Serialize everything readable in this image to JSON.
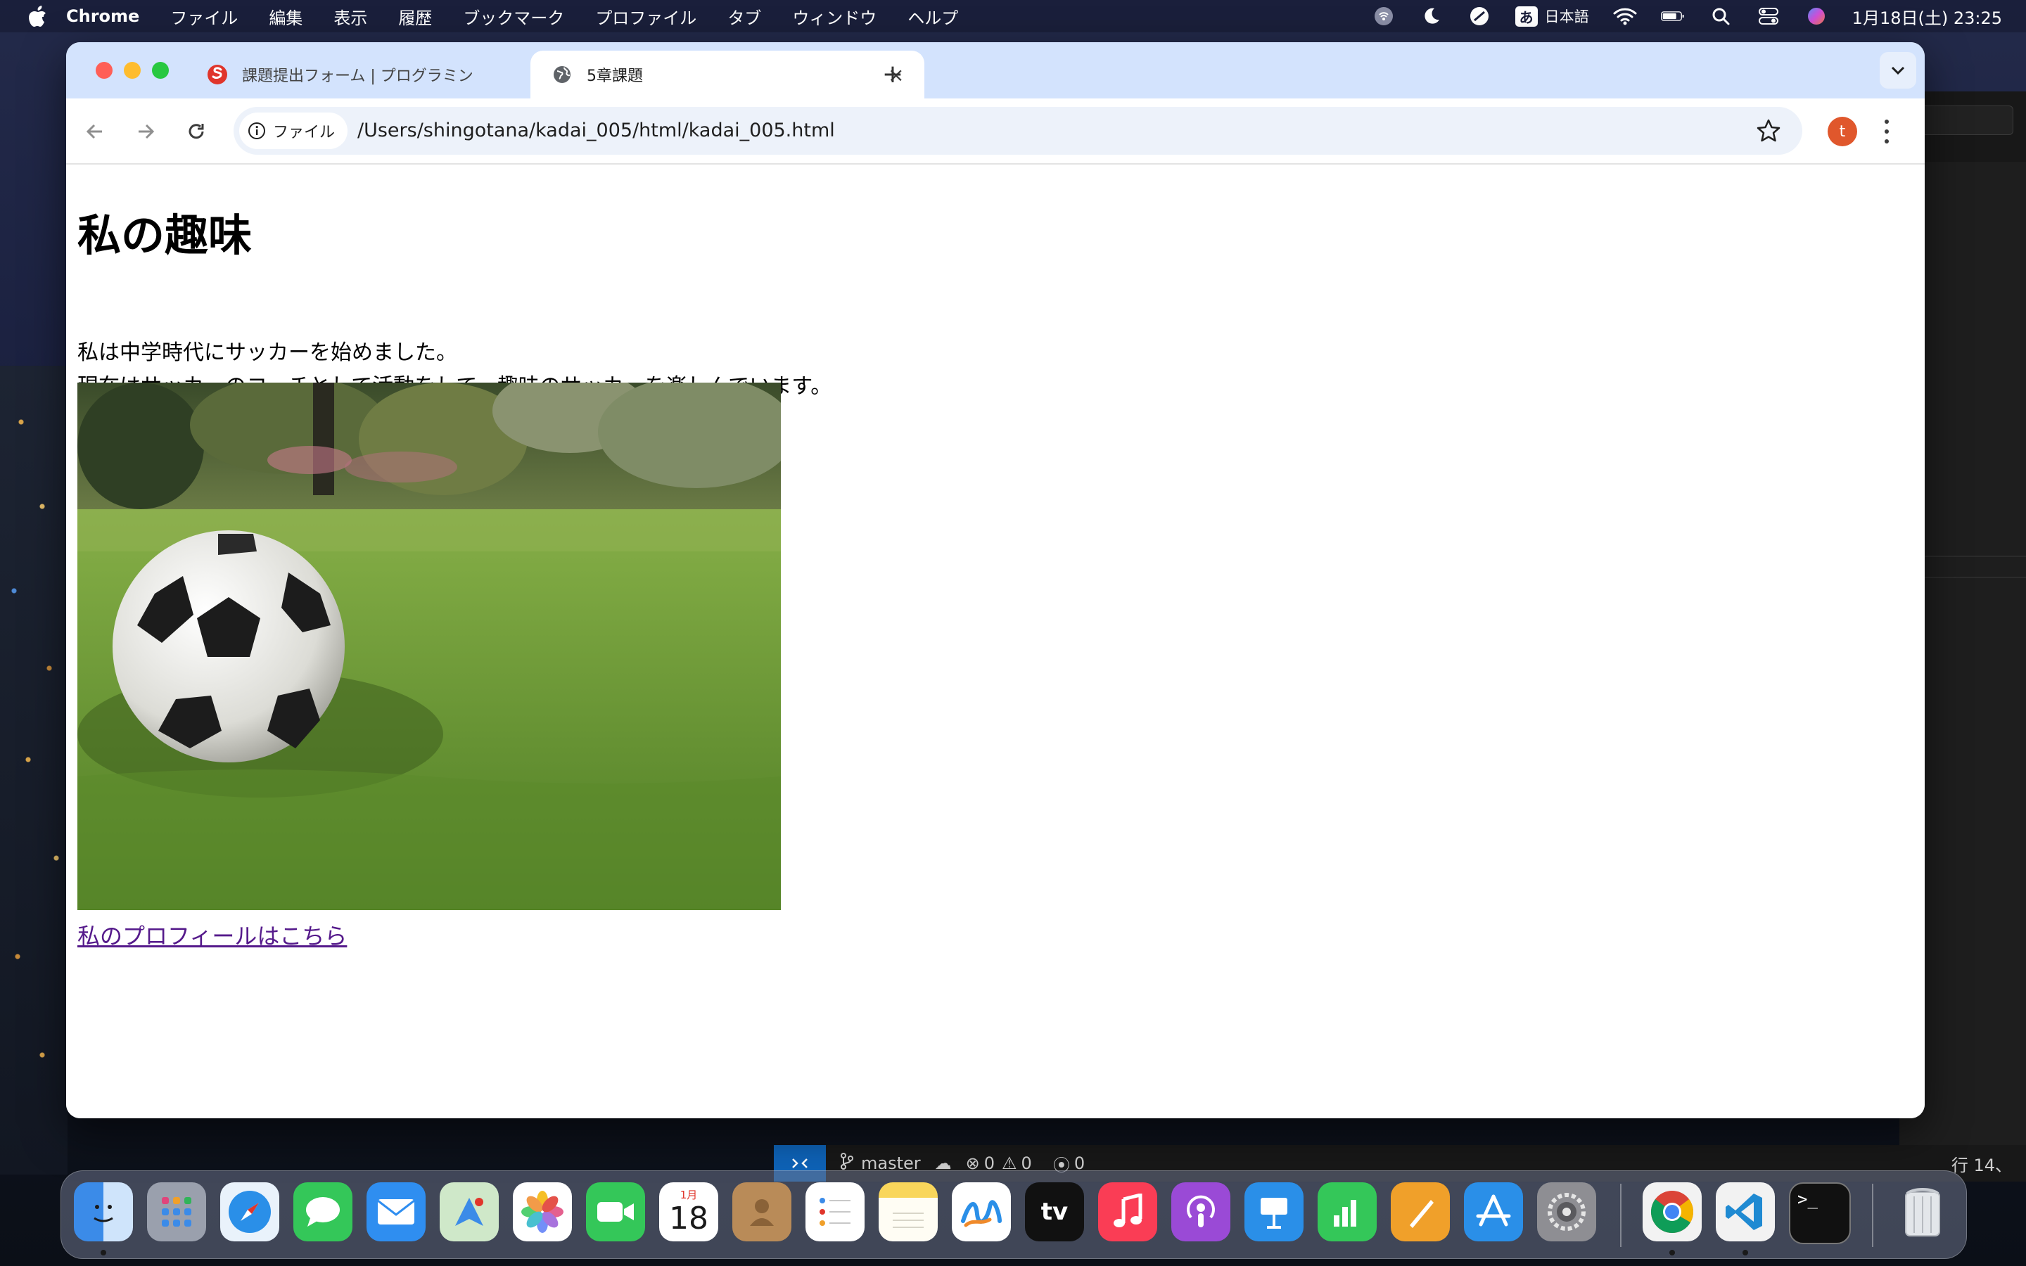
{
  "menubar": {
    "app": "Chrome",
    "items": [
      "ファイル",
      "編集",
      "表示",
      "履歴",
      "ブックマーク",
      "プロファイル",
      "タブ",
      "ウィンドウ",
      "ヘルプ"
    ],
    "input_mode": "あ",
    "input_lang": "日本語",
    "datetime": "1月18日(土) 23:25"
  },
  "browser": {
    "tabs": [
      {
        "title": "課題提出フォーム | プログラミング",
        "active": false
      },
      {
        "title": "5章課題",
        "active": true
      }
    ],
    "address": {
      "scheme_chip": "ファイル",
      "url": "/Users/shingotana/kadai_005/html/kadai_005.html"
    },
    "profile_initial": "t"
  },
  "page": {
    "heading": "私の趣味",
    "paragraph_line1": "私は中学時代にサッカーを始めました。",
    "paragraph_line2": "現在はサッカーのコーチとして活動をして、趣味のサッカーを楽しんでいます。",
    "link_text": "私のプロフィールはこちら"
  },
  "editor_status": {
    "branch": "master",
    "errors": "0",
    "warnings": "0",
    "ports": "0",
    "position": "行 14、"
  },
  "dock": {
    "calendar_month": "1月",
    "calendar_day": "18",
    "tv_label": "tv"
  },
  "colors": {
    "tabstrip": "#d3e3fd",
    "link_visited": "#551a8b",
    "avatar": "#e0572c",
    "vscode_remote": "#0e63b8"
  }
}
